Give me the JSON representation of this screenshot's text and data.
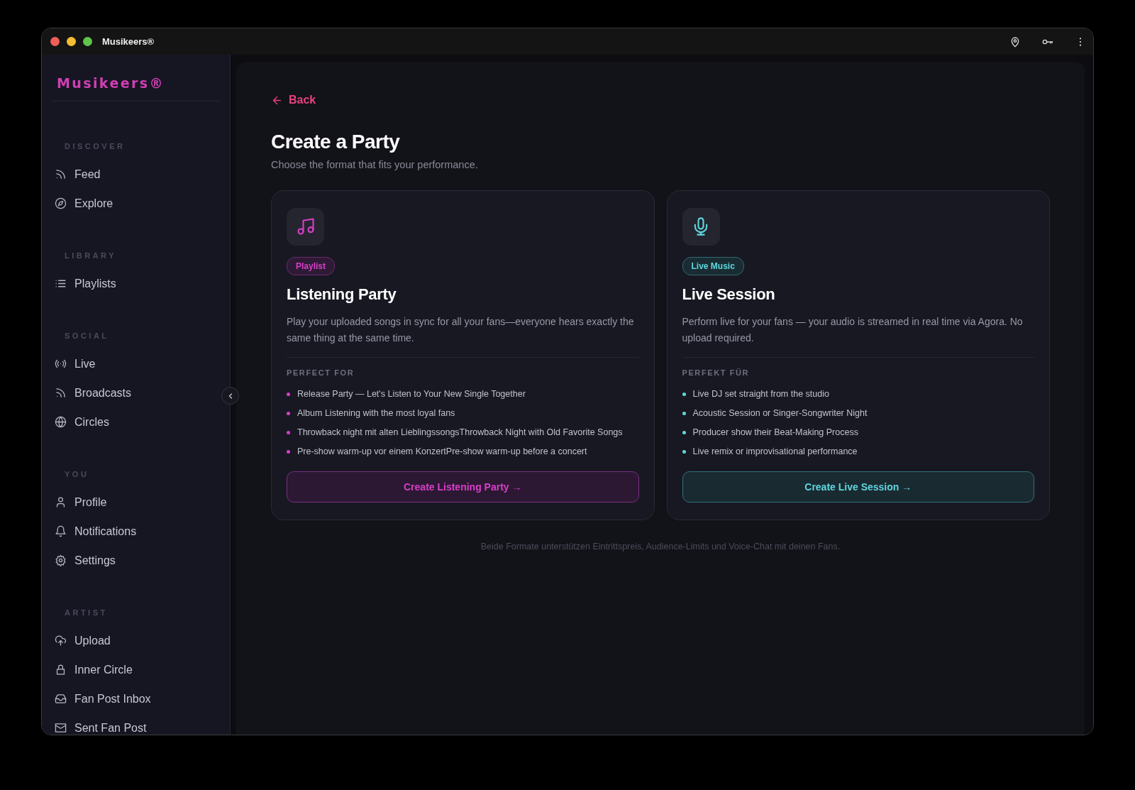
{
  "window": {
    "title": "Musikeers®"
  },
  "sidebar": {
    "logo": "Musikeers®",
    "sections": [
      {
        "heading": "DISCOVER",
        "items": [
          {
            "label": "Feed",
            "kind": "rss"
          },
          {
            "label": "Explore",
            "kind": "compass"
          }
        ]
      },
      {
        "heading": "LIBRARY",
        "items": [
          {
            "label": "Playlists",
            "kind": "list"
          }
        ]
      },
      {
        "heading": "SOCIAL",
        "items": [
          {
            "label": "Live",
            "kind": "radio"
          },
          {
            "label": "Broadcasts",
            "kind": "rss"
          },
          {
            "label": "Circles",
            "kind": "globe"
          }
        ]
      },
      {
        "heading": "YOU",
        "items": [
          {
            "label": "Profile",
            "kind": "user"
          },
          {
            "label": "Notifications",
            "kind": "bell"
          },
          {
            "label": "Settings",
            "kind": "gear"
          }
        ]
      },
      {
        "heading": "ARTIST",
        "items": [
          {
            "label": "Upload",
            "kind": "upload"
          },
          {
            "label": "Inner Circle",
            "kind": "lock"
          },
          {
            "label": "Fan Post Inbox",
            "kind": "inbox"
          },
          {
            "label": "Sent Fan Post",
            "kind": "mail"
          }
        ]
      }
    ]
  },
  "back": "Back",
  "title": "Create a Party",
  "subtitle": "Choose the format that fits your performance.",
  "cards": [
    {
      "kind": "playlist",
      "badge": "Playlist",
      "title": "Listening Party",
      "description": "Play your uploaded songs in sync for all your fans—everyone hears exactly the same thing at the same time.",
      "list_heading": "PERFECT FOR",
      "items": [
        "Release Party — Let's Listen to Your New Single Together",
        "Album Listening with the most loyal fans",
        "Throwback night mit alten LieblingssongsThrowback Night with Old Favorite Songs",
        "Pre-show warm-up vor einem KonzertPre-show warm-up before a concert"
      ],
      "button": "Create Listening Party →"
    },
    {
      "kind": "live",
      "badge": "Live Music",
      "title": "Live Session",
      "description": "Perform live for your fans — your audio is streamed in real time via Agora. No upload required.",
      "list_heading": "PERFEKT FÜR",
      "items": [
        "Live DJ set straight from the studio",
        "Acoustic Session or Singer-Songwriter Night",
        "Producer show their Beat-Making Process",
        "Live remix or improvisational performance"
      ],
      "button": "Create Live Session →"
    }
  ],
  "footnote": "Beide Formate unterstützen Eintrittspreis, Audience-Limits und Voice-Chat mit deinen Fans."
}
